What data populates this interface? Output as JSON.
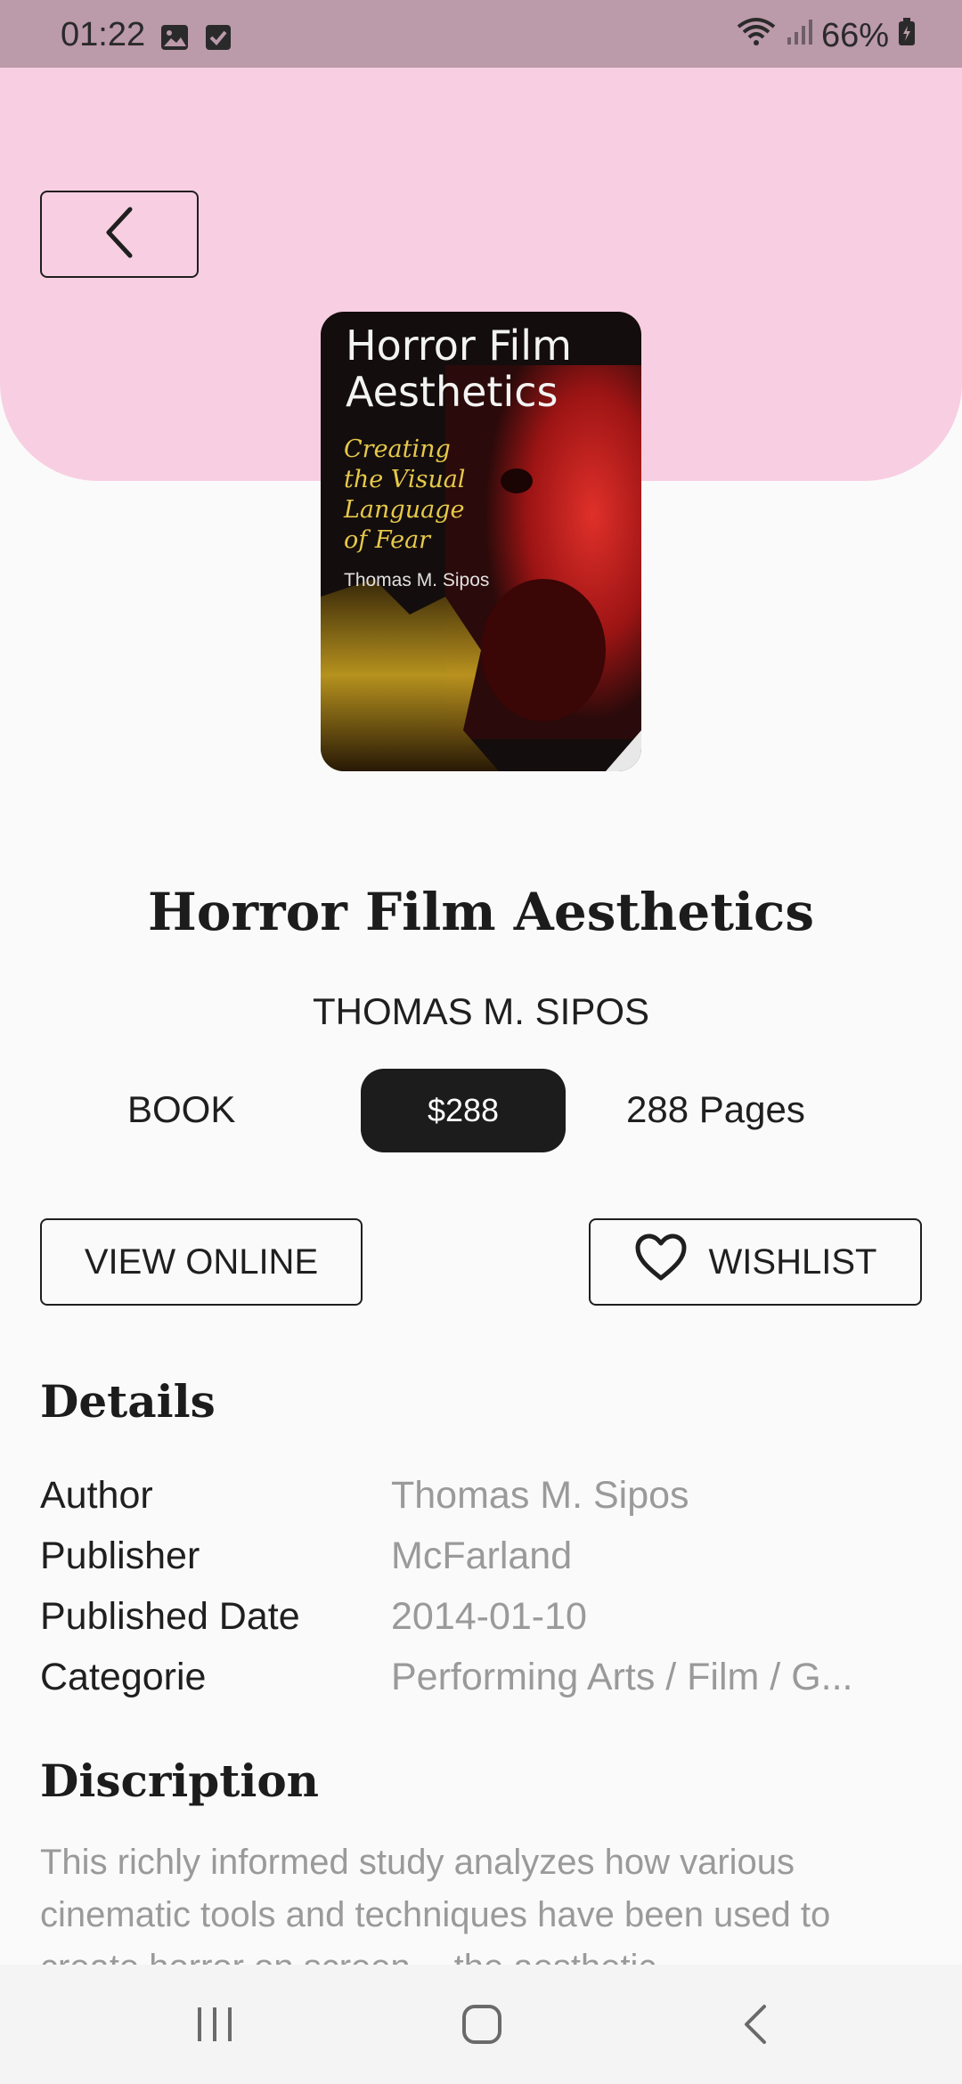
{
  "status_bar": {
    "time": "01:22",
    "battery": "66%",
    "icons": [
      "image-icon",
      "checkbox-icon",
      "wifi-icon",
      "signal-icon",
      "battery-icon"
    ]
  },
  "header": {
    "back_icon": "chevron-left-icon",
    "background": "#f8cfe2"
  },
  "cover": {
    "title_line1": "Horror Film",
    "title_line2": "Aesthetics",
    "subtitle_lines": [
      "Creating",
      "the Visual",
      "Language",
      "of Fear"
    ],
    "author": "Thomas M. Sipos"
  },
  "book": {
    "title": "Horror Film Aesthetics",
    "author_caps": "THOMAS M. SIPOS",
    "format": "BOOK",
    "price": "$288",
    "pages": "288 Pages"
  },
  "actions": {
    "view_online": "VIEW ONLINE",
    "wishlist": "WISHLIST",
    "wishlist_icon": "heart-icon"
  },
  "details": {
    "heading": "Details",
    "rows": [
      {
        "label": "Author",
        "value": "Thomas M. Sipos"
      },
      {
        "label": "Publisher",
        "value": "McFarland"
      },
      {
        "label": "Published Date",
        "value": "2014-01-10"
      },
      {
        "label": "Categorie",
        "value": "Performing Arts / Film / G..."
      }
    ]
  },
  "description": {
    "heading": "Discription",
    "text": "This richly informed study analyzes how various cinematic tools and techniques have been used to create horror on screen -- the aesthetic"
  },
  "nav_bar": {
    "icons": [
      "recent-apps-icon",
      "home-icon",
      "back-icon"
    ]
  }
}
